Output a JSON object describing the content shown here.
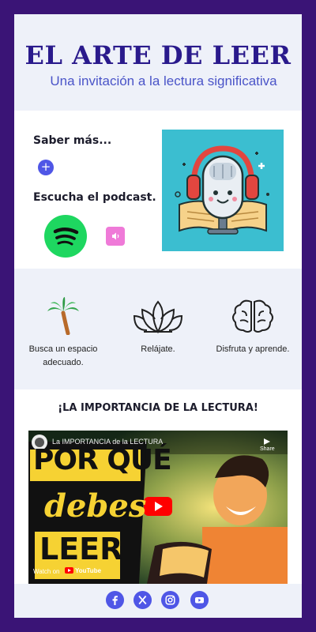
{
  "header": {
    "title": "EL ARTE DE LEER",
    "subtitle": "Una invitación a la lectura significativa"
  },
  "podcast": {
    "saber_mas": "Saber más...",
    "plus_symbol": "+",
    "escucha": "Escucha el podcast.",
    "image_icon": "microphone-book-illustration",
    "spotify_icon": "spotify-icon",
    "sound_icon": "speaker-icon"
  },
  "steps": [
    {
      "icon": "palm-tree-icon",
      "label": "Busca un espacio adecuado."
    },
    {
      "icon": "lotus-icon",
      "label": "Relájate."
    },
    {
      "icon": "brain-icon",
      "label": "Disfruta y aprende."
    }
  ],
  "video": {
    "heading": "¡LA IMPORTANCIA DE LA LECTURA!",
    "title": "La IMPORTANCIA de la LECTURA",
    "thumb_line1": "POR QUÉ",
    "thumb_line2": "debes",
    "thumb_line3": "LEER",
    "share": "Share",
    "watch_on": "Watch on",
    "youtube": "YouTube"
  },
  "footer": {
    "social": [
      "facebook-icon",
      "x-icon",
      "instagram-icon",
      "youtube-icon"
    ]
  },
  "colors": {
    "background": "#3a1476",
    "title": "#2a1a8c",
    "accent": "#4f56e6",
    "section_bg": "#eef1f9",
    "spotify": "#1ed760",
    "pink": "#ef7ad8"
  }
}
